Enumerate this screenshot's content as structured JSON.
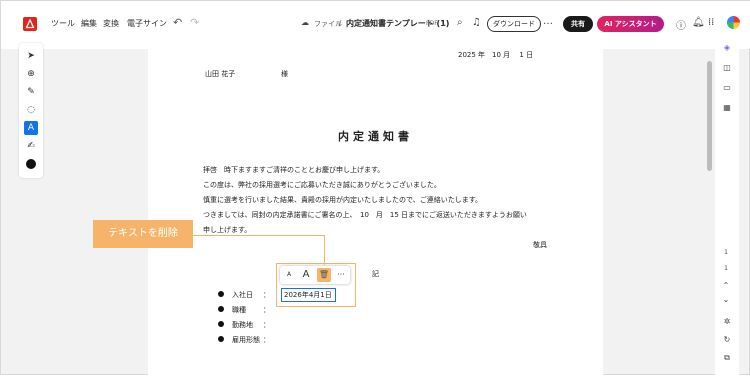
{
  "topbar": {
    "menu": [
      "ツール",
      "編集",
      "変換",
      "電子サイン"
    ],
    "breadcrumb_parent": "ファイル",
    "breadcrumb_sep": "/",
    "document_title": "内定通知書テンプレート (1)",
    "doc_type": "PDF",
    "download_label": "ダウンロード",
    "more_label": "…",
    "share_label": "共有",
    "ai_label": "AI アシスタント"
  },
  "document": {
    "date": "2025 年　10 月　 1 日",
    "recipient_name": "山田 花子",
    "honorific": "様",
    "title": "内定通知書",
    "paragraphs": [
      "拝啓　時下ますますご清祥のこととお慶び申し上げます。",
      "この度は、弊社の採用選考にご応募いただき誠にありがとうございました。",
      "慎重に選考を行いました結果、貴殿の採用が内定いたしましたので、ご連絡いたします。",
      "つきましては、同封の内定承諾書にご署名の上、　10　月　15 日までにご返送いただきますようお願い",
      "申し上げます。"
    ],
    "closing": "敬具",
    "ki": "記",
    "fields": [
      {
        "label": "入社日",
        "sep": "："
      },
      {
        "label": "職種",
        "sep": "："
      },
      {
        "label": "勤務地",
        "sep": "："
      },
      {
        "label": "雇用形態",
        "sep": "："
      }
    ],
    "edit_value": "2026年4月1日"
  },
  "edit_toolbar": {
    "small_a": "A",
    "large_a": "A",
    "more": "···"
  },
  "callout": {
    "text": "テキストを削除"
  },
  "page_indicator": {
    "current": "1",
    "total": "1"
  },
  "colors": {
    "accent": "#1473e6",
    "callout": "#f5b46a",
    "brand_red": "#e0251b"
  }
}
